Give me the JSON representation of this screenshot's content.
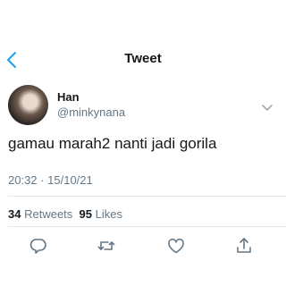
{
  "header": {
    "title": "Tweet",
    "back_icon": "chevron-left-icon",
    "accent_color": "#1da1f2"
  },
  "tweet": {
    "author": {
      "name": "Han",
      "handle": "@minkynana"
    },
    "text": "gamau marah2 nanti jadi gorila",
    "time": "20:32",
    "separator": "·",
    "date": "15/10/21",
    "stats": {
      "retweets_count": "34",
      "retweets_label": "Retweets",
      "likes_count": "95",
      "likes_label": "Likes"
    }
  },
  "actions": [
    {
      "icon": "reply-icon"
    },
    {
      "icon": "retweet-icon"
    },
    {
      "icon": "like-icon"
    },
    {
      "icon": "share-icon"
    }
  ]
}
